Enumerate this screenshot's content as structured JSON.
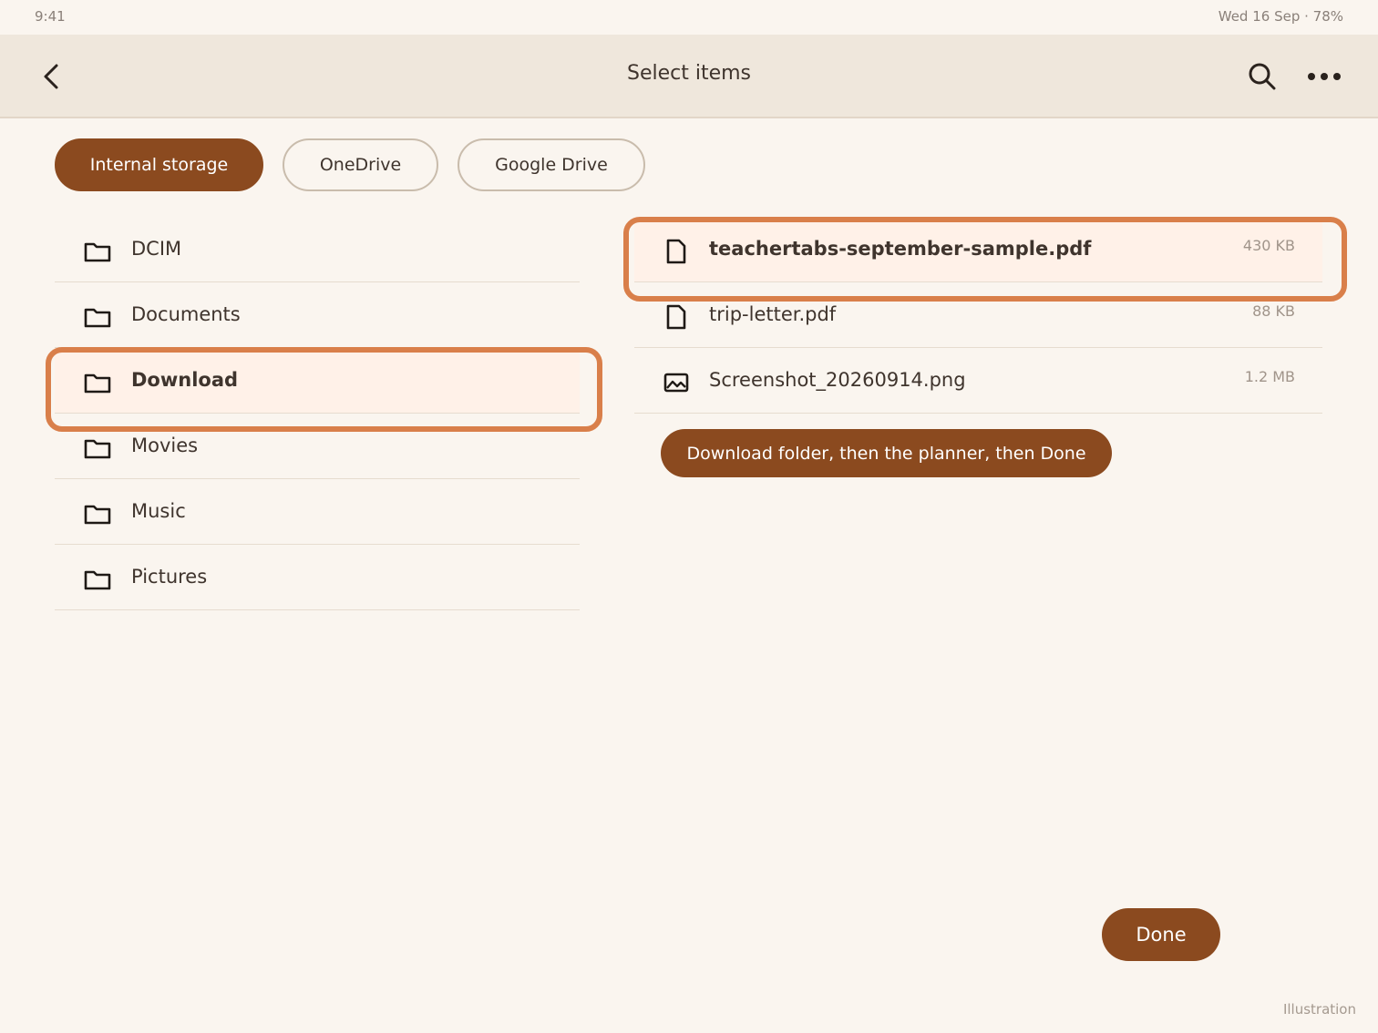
{
  "status_bar": {
    "time": "9:41",
    "right": "Wed 16 Sep · 78%"
  },
  "app_bar": {
    "title": "Select items",
    "back_icon": "chevron-left-icon",
    "search_icon": "search-icon",
    "more_icon": "more-horizontal-icon"
  },
  "sources": [
    {
      "label": "Internal storage",
      "active": true
    },
    {
      "label": "OneDrive",
      "active": false
    },
    {
      "label": "Google Drive",
      "active": false
    }
  ],
  "folders": [
    {
      "label": "DCIM",
      "selected": false
    },
    {
      "label": "Documents",
      "selected": false
    },
    {
      "label": "Download",
      "selected": true
    },
    {
      "label": "Movies",
      "selected": false
    },
    {
      "label": "Music",
      "selected": false
    },
    {
      "label": "Pictures",
      "selected": false
    }
  ],
  "files": [
    {
      "name": "teachertabs-september-sample.pdf",
      "size": "430 KB",
      "icon": "file-icon",
      "selected": true
    },
    {
      "name": "trip-letter.pdf",
      "size": "88 KB",
      "icon": "file-icon",
      "selected": false
    },
    {
      "name": "Screenshot_20260914.png",
      "size": "1.2 MB",
      "icon": "image-icon",
      "selected": false
    }
  ],
  "hint": "Download folder, then the planner, then Done",
  "done_label": "Done",
  "caption": "Illustration",
  "colors": {
    "accent": "#8b4a1f",
    "highlight": "#d97f4a",
    "background": "#faf5ef",
    "app_bar": "#efe7dc"
  }
}
